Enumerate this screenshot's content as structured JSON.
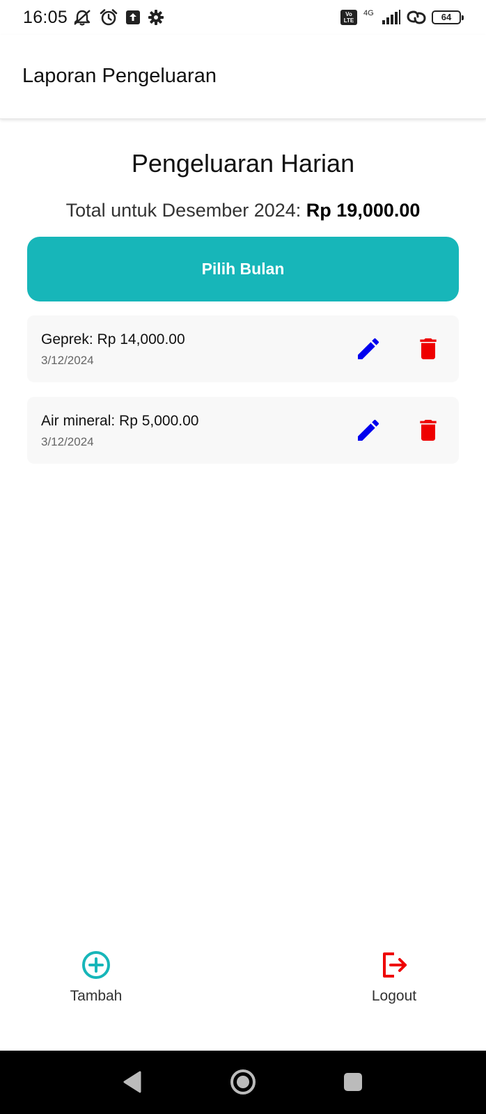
{
  "status_bar": {
    "time": "16:05",
    "network_type": "4G",
    "battery_level": "64",
    "icons": [
      "muted-notifications-icon",
      "alarm-icon",
      "upload-icon",
      "settings-gear-icon",
      "volte-icon",
      "signal-icon",
      "hotspot-link-icon",
      "battery-icon"
    ]
  },
  "app_bar": {
    "title": "Laporan Pengeluaran"
  },
  "main": {
    "heading": "Pengeluaran Harian",
    "total_label": "Total untuk Desember 2024: ",
    "total_amount": "Rp 19,000.00",
    "pick_month_label": "Pilih Bulan"
  },
  "expenses": [
    {
      "title": "Geprek: Rp 14,000.00",
      "date": "3/12/2024",
      "actions": [
        "edit-icon",
        "delete-icon"
      ]
    },
    {
      "title": "Air mineral: Rp 5,000.00",
      "date": "3/12/2024",
      "actions": [
        "edit-icon",
        "delete-icon"
      ]
    }
  ],
  "bottom_nav": {
    "add_label": "Tambah",
    "logout_label": "Logout"
  },
  "colors": {
    "accent": "#17b6b9",
    "edit": "#0000ee",
    "delete": "#ee0000",
    "card_background": "#f8f8f8",
    "system_nav": "#000000"
  }
}
